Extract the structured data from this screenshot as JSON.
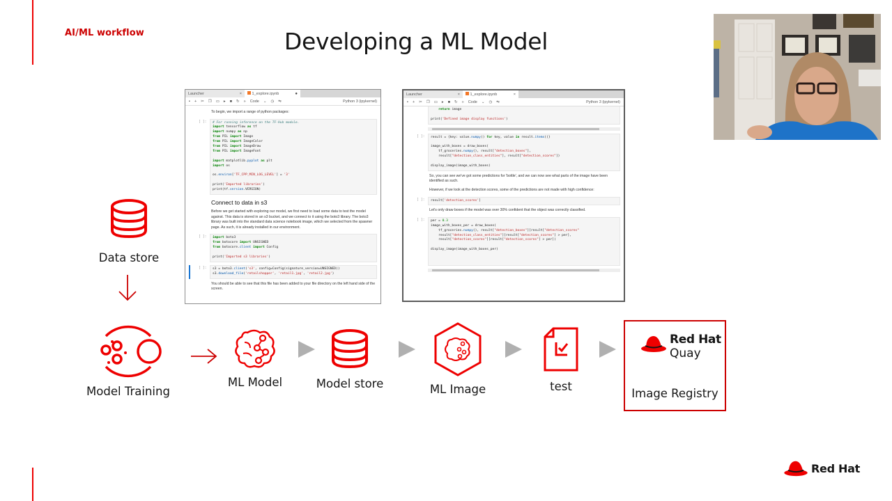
{
  "slide": {
    "section_label": "AI/ML workflow",
    "title": "Developing a ML Model",
    "accent_color": "#ee0000"
  },
  "notebook_left": {
    "tabs": [
      {
        "label": "Launcher",
        "close": "×"
      },
      {
        "label": "1_explore.ipynb",
        "close": "●"
      }
    ],
    "toolbar": {
      "cell_type": "Code",
      "kernel": "Python 3 (ipykernel)"
    },
    "intro_text": "To begin, we import a range of python packages:",
    "cell1_prompt": "[ ]:",
    "cell1_lines": [
      "# For running inference on the TF-Hub module.",
      "import tensorflow as tf",
      "import numpy as np",
      "from PIL import Image",
      "from PIL import ImageColor",
      "from PIL import ImageDraw",
      "from PIL import ImageFont",
      "",
      "import matplotlib.pyplot as plt",
      "import os",
      "",
      "os.environ['TF_CPP_MIN_LOG_LEVEL'] = '3'",
      "",
      "print('Imported libraries')",
      "print(tf.version.VERSION)"
    ],
    "heading": "Connect to data in s3",
    "paragraph": "Before we get started with exploring our model, we first need to load some data to test the model against. This data is stored in an s3 bucket, and we connect to it using the boto3 library. The boto3 library was built into the standard data science notebook image, which we selected from the spawner page. As such, it is already installed in our environment.",
    "cell2_prompt": "[ ]:",
    "cell2_lines": [
      "import boto3",
      "from botocore import UNSIGNED",
      "from botocore.client import Config",
      "",
      "print('Imported s3 libraries')"
    ],
    "cell3_prompt": "[ ]:",
    "cell3_lines": [
      "s3 = boto3.client('s3', config=Config(signature_version=UNSIGNED))",
      "s3.download_file('retailshopper', 'retail1.jpg', 'retail2.jpg')"
    ],
    "footer_text": "You should be able to see that this file has been added to your file directory on the left hand side of the screen."
  },
  "notebook_right": {
    "tabs": [
      {
        "label": "Launcher",
        "close": "×"
      },
      {
        "label": "1_explore.ipynb",
        "close": "×"
      }
    ],
    "toolbar": {
      "cell_type": "Code",
      "kernel": "Python 3 (ipykernel)"
    },
    "cell0_lines": [
      "    return image",
      "",
      "print('Defined image display functions')"
    ],
    "cell1_prompt": "[ ]:",
    "cell1_lines": [
      "result = {key: value.numpy() for key, value in result.items()}",
      "",
      "image_with_boxes = draw_boxes(",
      "    tf_groceries.numpy(), result[\"detection_boxes\"],",
      "    result[\"detection_class_entities\"], result[\"detection_scores\"])",
      "",
      "display_image(image_with_boxes)"
    ],
    "para1": "So, you can see we've got some predictions for 'bottle', and we can now see what parts of the image have been identified as such.",
    "para2": "However, if we look at the detection scores, some of the predictions are not made with high confidence:",
    "cell2_prompt": "[ ]:",
    "cell2_lines": [
      "result['detection_scores']"
    ],
    "para3": "Let's only draw boxes if the model was over 30% confident that the object was correctly classified.",
    "cell3_prompt": "[ ]:",
    "cell3_lines": [
      "per = 0.3",
      "image_with_boxes_per = draw_boxes(",
      "    tf_groceries.numpy(), result[\"detection_boxes\"][result[\"detection_scores\"",
      "    result[\"detection_class_entities\"][result[\"detection_scores\"] > per],",
      "    result[\"detection_scores\"][result[\"detection_scores\"] > per])",
      "",
      "display_image(image_with_boxes_per)"
    ]
  },
  "workflow": {
    "data_store": {
      "label": "Data store",
      "icon": "database-icon"
    },
    "stages": [
      {
        "label": "Model Training",
        "icon": "model-training-icon"
      },
      {
        "label": "ML Model",
        "icon": "brain-network-icon"
      },
      {
        "label": "Model store",
        "icon": "database-icon"
      },
      {
        "label": "ML Image",
        "icon": "hexagon-brain-icon"
      },
      {
        "label": "test",
        "icon": "checklist-document-icon"
      },
      {
        "label": "Image Registry",
        "icon": "red-hat-quay-logo"
      }
    ],
    "quay_brand": "Red Hat",
    "quay_product": "Quay"
  },
  "footer": {
    "brand": "Red Hat"
  }
}
